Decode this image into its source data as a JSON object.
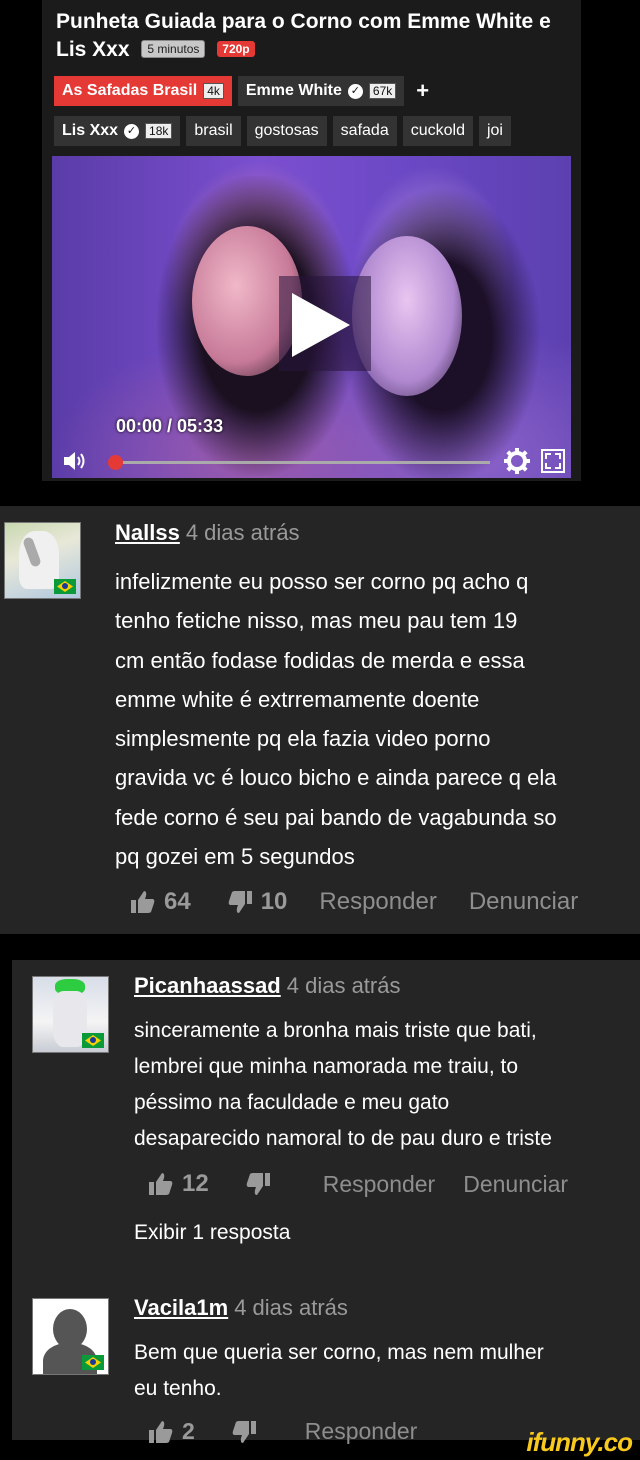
{
  "video": {
    "title": "Punheta Guiada para o Corno com Emme White e Lis Xxx",
    "duration_badge": "5 minutos",
    "quality_badge": "720p",
    "time_display": "00:00 / 05:33",
    "tags_row1": [
      {
        "label": "As Safadas Brasil",
        "count": "4k"
      },
      {
        "label": "Emme White",
        "count": "67k"
      }
    ],
    "plus": "+",
    "tags_row2_model": {
      "label": "Lis Xxx",
      "count": "18k"
    },
    "tags_row2": [
      "brasil",
      "gostosas",
      "safada",
      "cuckold",
      "joi"
    ],
    "progress_fraction": 0.0
  },
  "comments": [
    {
      "user": "Nallss",
      "time": "4 dias atrás",
      "lines": [
        "infelizmente eu posso ser corno pq acho q",
        "tenho fetiche nisso, mas meu pau tem 19",
        "cm então fodase fodidas de merda e essa",
        "emme white é extrremamente doente",
        "simplesmente pq ela fazia video porno",
        "gravida vc é louco bicho e ainda parece q ela",
        "fede corno é seu pai bando de vagabunda so",
        "pq gozei em 5 segundos"
      ],
      "likes": "64",
      "dislikes": "10",
      "reply_label": "Responder",
      "report_label": "Denunciar"
    },
    {
      "user": "Picanhaassad",
      "time": "4 dias atrás",
      "lines": [
        "sinceramente a bronha mais triste que bati,",
        "lembrei que minha namorada me traiu, to",
        "péssimo na faculdade e meu gato",
        "desaparecido namoral to de pau duro e triste"
      ],
      "likes": "12",
      "dislikes": "",
      "reply_label": "Responder",
      "report_label": "Denunciar",
      "show_replies": "Exibir 1 resposta"
    },
    {
      "user": "Vacila1m",
      "time": "4 dias atrás",
      "lines": [
        "Bem que queria ser corno, mas nem mulher",
        "eu tenho."
      ],
      "likes": "2",
      "dislikes": "",
      "reply_label": "Responder"
    }
  ],
  "watermark": "ifunny.co",
  "colors": {
    "accent_red": "#e53935",
    "card_bg": "#252525",
    "muted_text": "#8e8e8e",
    "watermark": "#f7c91e"
  }
}
